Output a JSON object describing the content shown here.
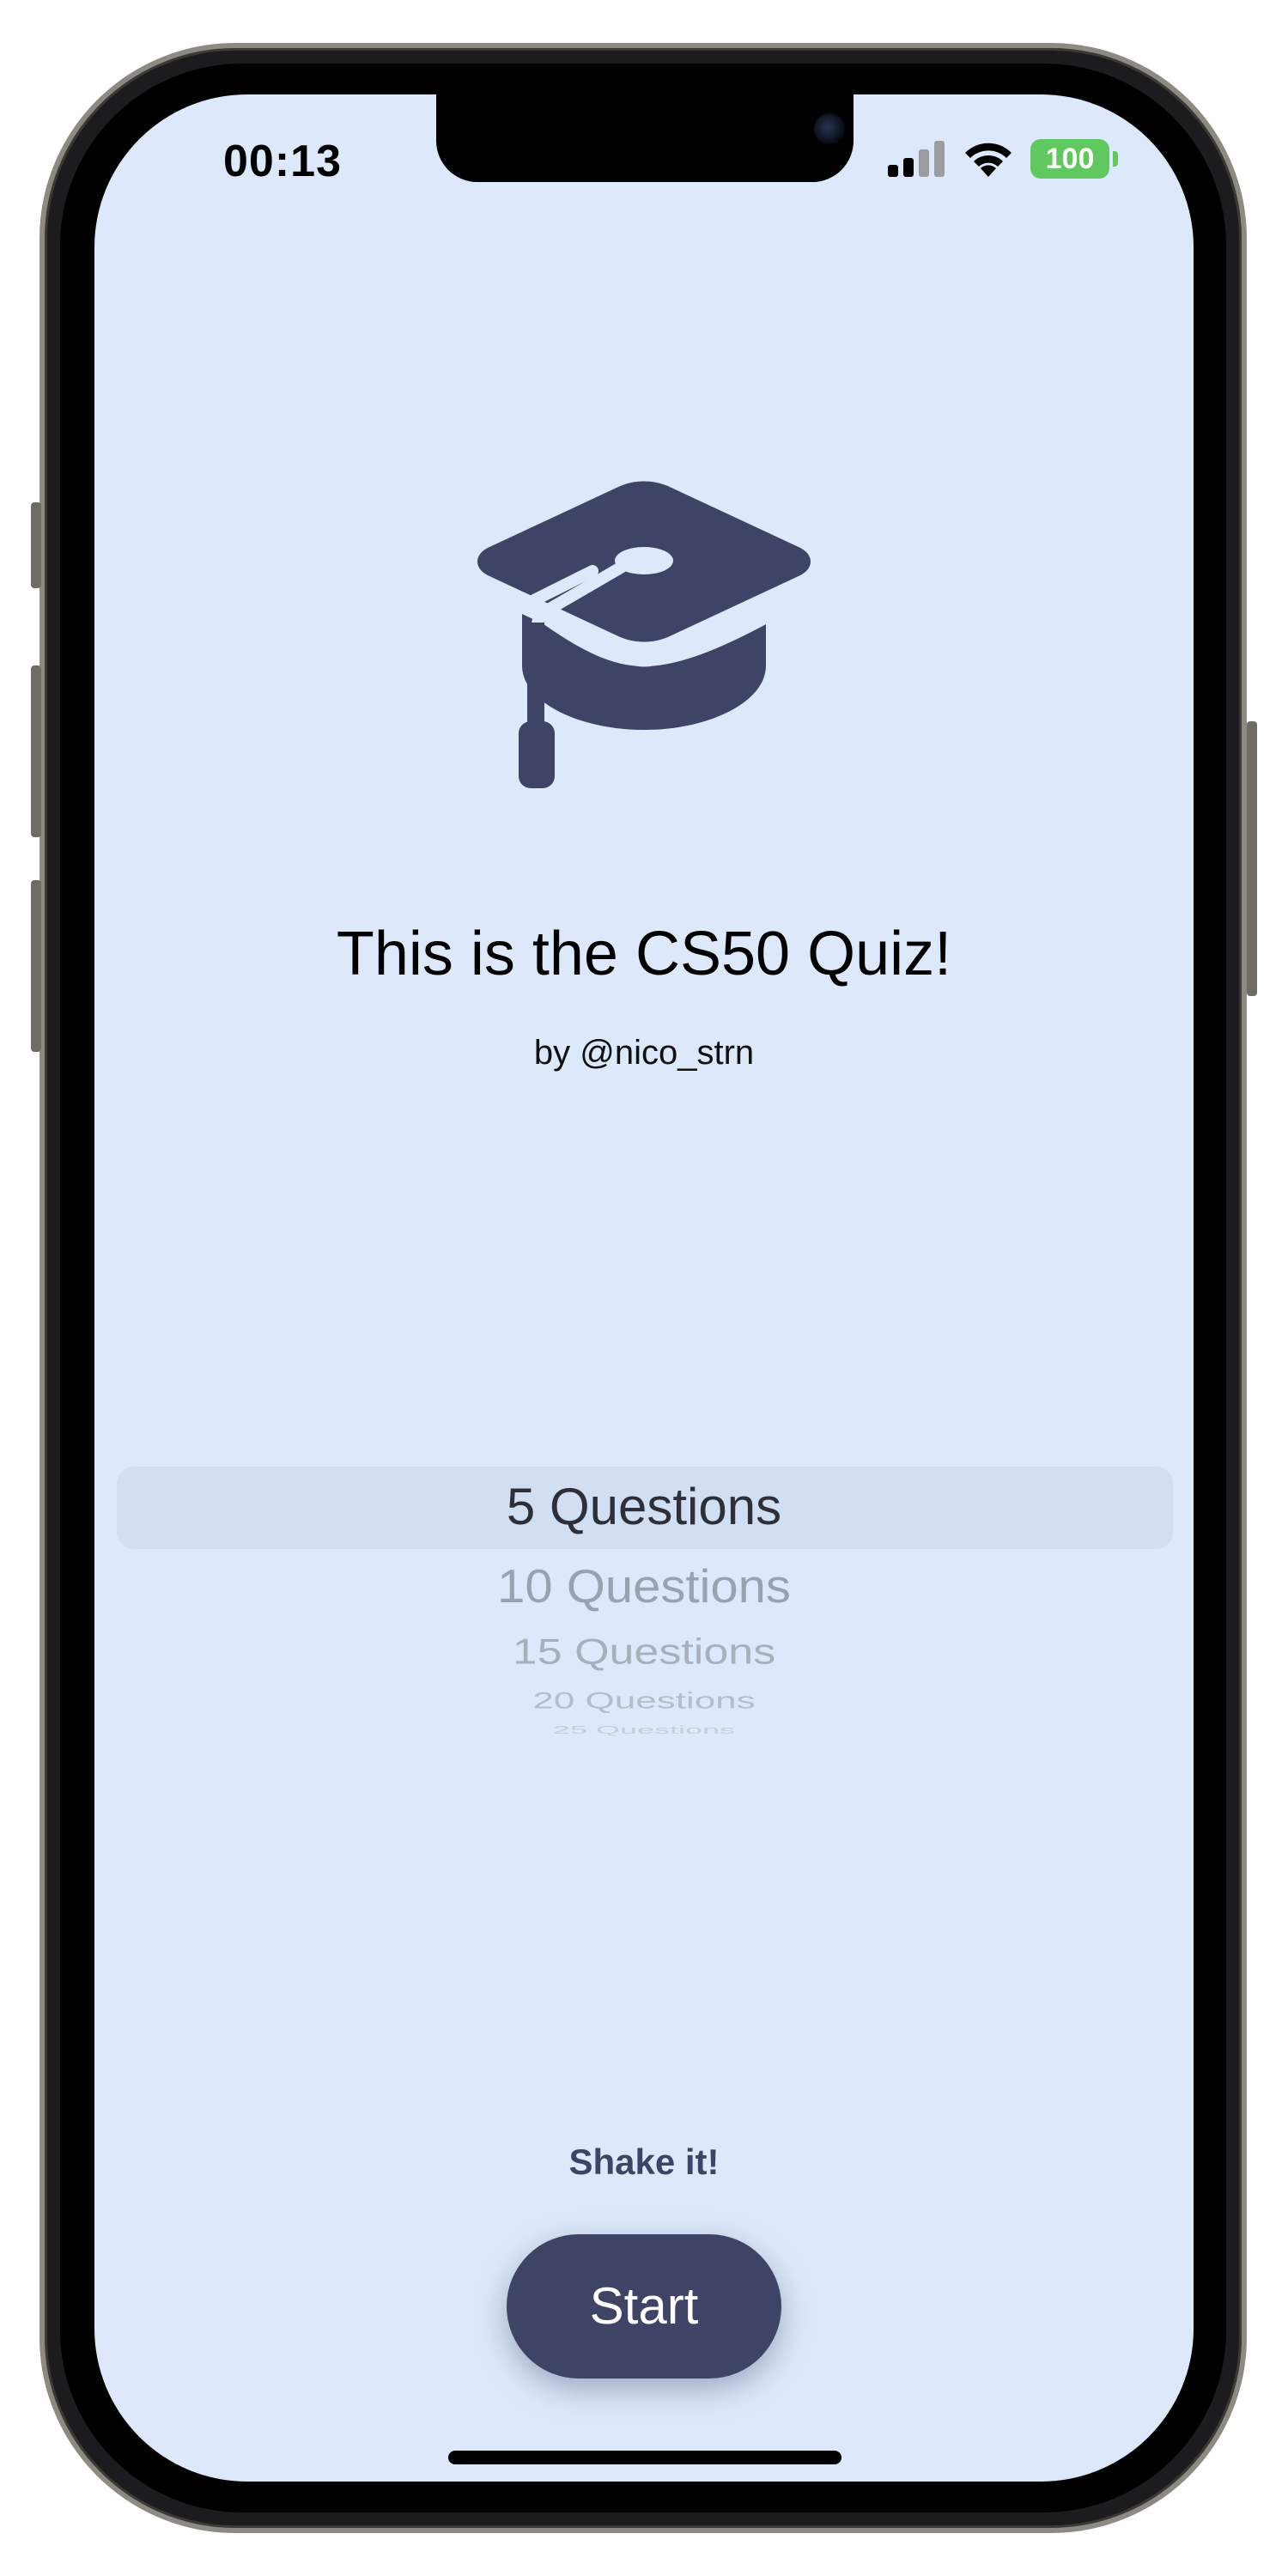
{
  "status_bar": {
    "time": "00:13",
    "battery": "100",
    "signal_icon": "cellular-signal-icon",
    "wifi_icon": "wifi-icon"
  },
  "hero": {
    "icon": "graduation-cap-icon",
    "icon_color": "#3f4467"
  },
  "title": "This is the CS50 Quiz!",
  "subtitle": "by @nico_strn",
  "picker": {
    "selected": "5 Questions",
    "options": [
      "5 Questions",
      "10 Questions",
      "15 Questions",
      "20 Questions",
      "25 Questions"
    ]
  },
  "hint": "Shake it!",
  "start_button": {
    "label": "Start"
  },
  "colors": {
    "background": "#dde9fb",
    "accent": "#3f4467",
    "battery": "#5fc85f"
  }
}
